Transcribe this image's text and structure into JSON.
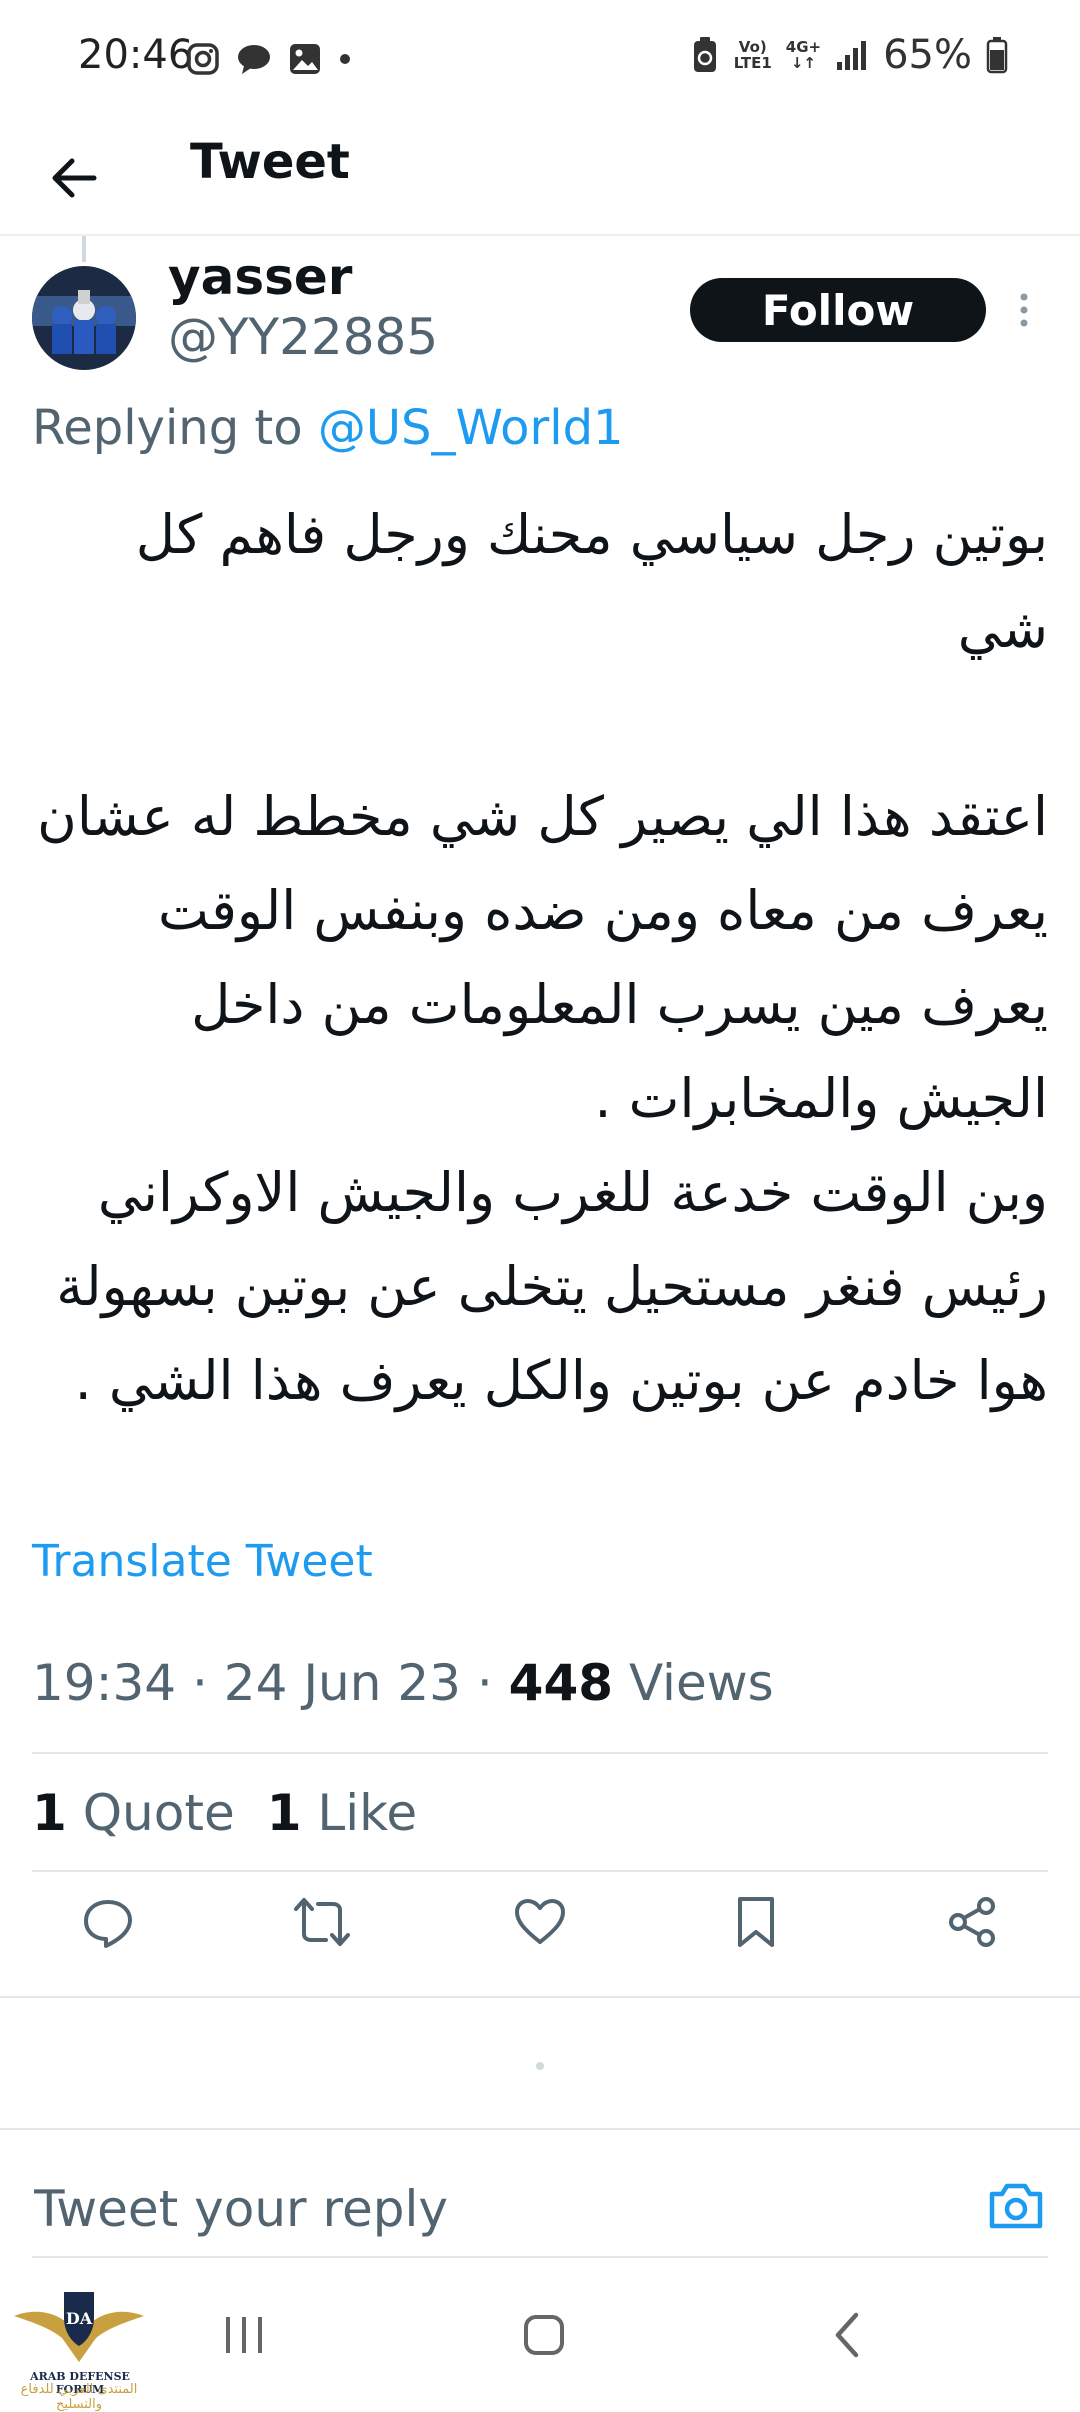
{
  "status_bar": {
    "time": "20:46",
    "network_top": "Vo)",
    "network_bottom": "LTE1",
    "data_top": "4G+",
    "data_bottom": "↓↑",
    "battery": "65%"
  },
  "header": {
    "title": "Tweet",
    "back_icon": "arrow-left-icon"
  },
  "tweet": {
    "author_name": "yasser",
    "author_handle": "@YY22885",
    "follow_label": "Follow",
    "replying_prefix": "Replying to ",
    "replying_handle": "@US_World1",
    "body": "بوتين رجل سياسي محنك ورجل فاهم كل شي\n\nاعتقد هذا الي يصير كل شي مخطط له عشان يعرف من معاه ومن ضده وبنفس الوقت يعرف مين يسرب المعلومات من داخل الجيش والمخابرات .\nوبن الوقت خدعة للغرب والجيش الاوكراني رئيس فنغر مستحيل يتخلى عن بوتين بسهولة هوا خادم عن بوتين والكل يعرف هذا الشي .",
    "translate_label": "Translate Tweet",
    "time": "19:34",
    "date": "24 Jun 23",
    "views_count": "448",
    "views_label": "Views",
    "quote_count": "1",
    "quote_label": "Quote",
    "like_count": "1",
    "like_label": "Like"
  },
  "actions": [
    "reply-icon",
    "retweet-icon",
    "like-icon",
    "bookmark-icon",
    "share-icon"
  ],
  "reply_box": {
    "placeholder": "Tweet your reply",
    "icon": "camera-icon"
  },
  "colors": {
    "accent": "#1d9bf0",
    "text": "#0f1419",
    "secondary": "#536471"
  },
  "watermark": {
    "line1": "ARAB DEFENSE FORUM",
    "line2": "المنتدى العربي للدفاع والتسليح",
    "logo_letters": "DA"
  }
}
